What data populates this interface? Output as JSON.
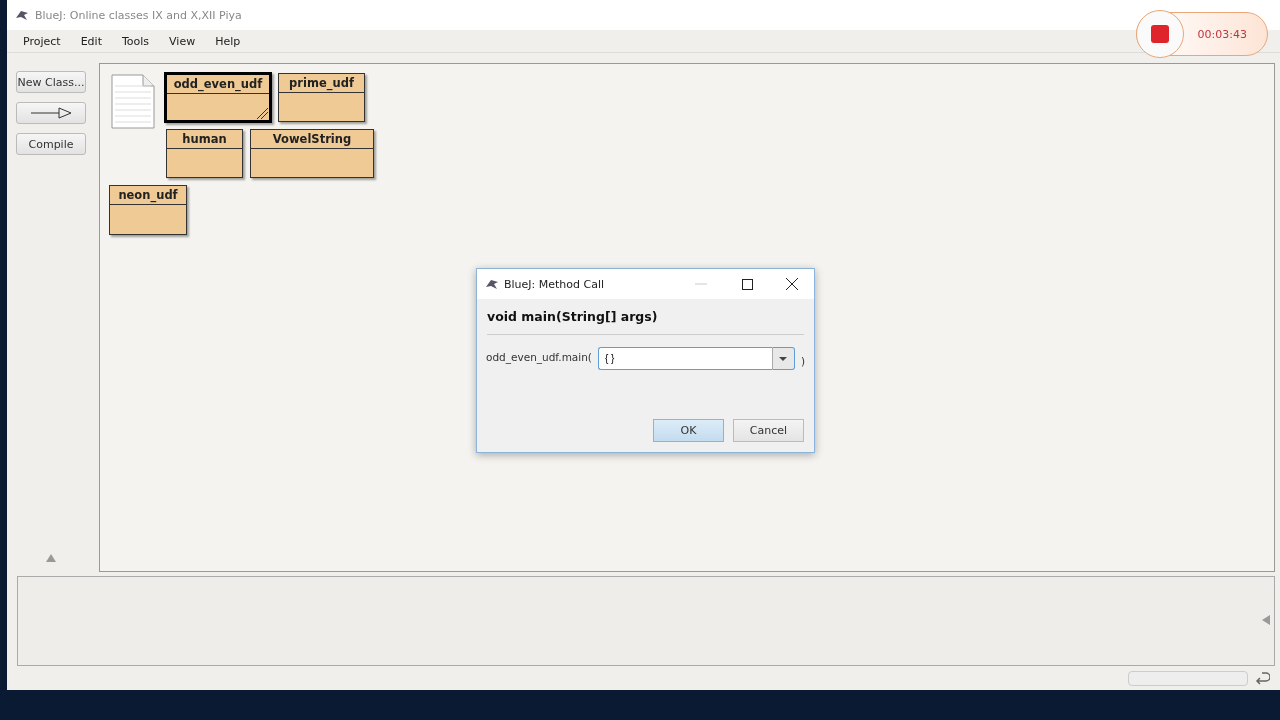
{
  "window": {
    "title": "BlueJ:  Online classes IX and X,XII Piya"
  },
  "menu": [
    "Project",
    "Edit",
    "Tools",
    "View",
    "Help"
  ],
  "toolbar": {
    "new_class": "New Class...",
    "compile": "Compile"
  },
  "classes": [
    {
      "name": "odd_even_udf",
      "selected": true
    },
    {
      "name": "prime_udf",
      "selected": false
    },
    {
      "name": "human",
      "selected": false
    },
    {
      "name": "VowelString",
      "selected": false
    },
    {
      "name": "neon_udf",
      "selected": false
    }
  ],
  "dialog": {
    "title": "BlueJ:  Method Call",
    "signature": "void main(String[] args)",
    "call_label": "odd_even_udf.main(",
    "argument": "{ }",
    "close_paren": ")",
    "buttons": [
      {
        "label": "OK",
        "selected": true
      },
      {
        "label": "Cancel",
        "selected": false
      }
    ]
  },
  "recorder": {
    "time": "00:03:43"
  }
}
